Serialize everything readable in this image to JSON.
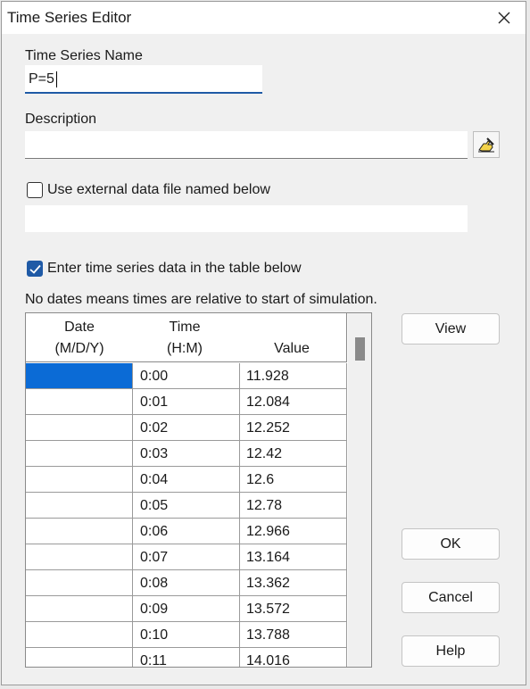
{
  "window": {
    "title": "Time Series Editor",
    "close_icon": "close-icon"
  },
  "name": {
    "label": "Time Series Name",
    "value": "P=5"
  },
  "description": {
    "label": "Description",
    "value": "",
    "button_icon": "hand-pencil-icon"
  },
  "external_file": {
    "label": "Use external data file named below",
    "checked": false,
    "value": ""
  },
  "table_mode": {
    "label": "Enter time series data in the table below",
    "checked": true
  },
  "note": "No dates means times are relative to start of simulation.",
  "table": {
    "headers": {
      "date_line1": "Date",
      "date_line2": "(M/D/Y)",
      "time_line1": "Time",
      "time_line2": "(H:M)",
      "value": "Value"
    },
    "rows": [
      {
        "date": "",
        "time": "0:00",
        "value": "11.928"
      },
      {
        "date": "",
        "time": "0:01",
        "value": "12.084"
      },
      {
        "date": "",
        "time": "0:02",
        "value": "12.252"
      },
      {
        "date": "",
        "time": "0:03",
        "value": "12.42"
      },
      {
        "date": "",
        "time": "0:04",
        "value": "12.6"
      },
      {
        "date": "",
        "time": "0:05",
        "value": "12.78"
      },
      {
        "date": "",
        "time": "0:06",
        "value": "12.966"
      },
      {
        "date": "",
        "time": "0:07",
        "value": "13.164"
      },
      {
        "date": "",
        "time": "0:08",
        "value": "13.362"
      },
      {
        "date": "",
        "time": "0:09",
        "value": "13.572"
      },
      {
        "date": "",
        "time": "0:10",
        "value": "13.788"
      },
      {
        "date": "",
        "time": "0:11",
        "value": "14.016"
      }
    ]
  },
  "buttons": {
    "view": "View",
    "ok": "OK",
    "cancel": "Cancel",
    "help": "Help"
  },
  "colors": {
    "accent": "#1f5aa6",
    "selection": "#0b6bd6"
  }
}
